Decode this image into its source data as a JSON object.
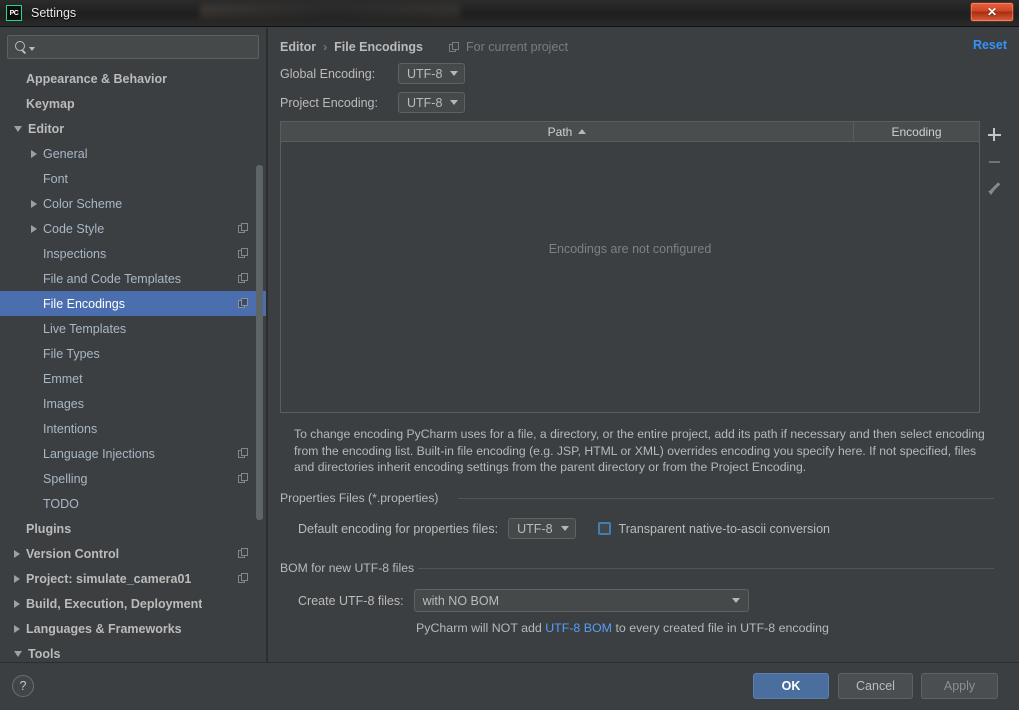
{
  "window": {
    "title": "Settings",
    "app_icon": "pycharm-icon",
    "close_label": "✕",
    "accent": "#21d789"
  },
  "sidebar": {
    "search": {
      "placeholder": "",
      "value": "",
      "icon": "search-icon"
    },
    "items": [
      {
        "label": "Appearance & Behavior",
        "level": 0,
        "arrow": "none",
        "bold": true,
        "scope_icon": false
      },
      {
        "label": "Keymap",
        "level": 0,
        "arrow": "none",
        "bold": true,
        "scope_icon": false
      },
      {
        "label": "Editor",
        "level": 0,
        "arrow": "expanded",
        "bold": true,
        "scope_icon": false
      },
      {
        "label": "General",
        "level": 1,
        "arrow": "collapsed",
        "bold": false,
        "scope_icon": false
      },
      {
        "label": "Font",
        "level": 1,
        "arrow": "none",
        "bold": false,
        "scope_icon": false
      },
      {
        "label": "Color Scheme",
        "level": 1,
        "arrow": "collapsed",
        "bold": false,
        "scope_icon": false
      },
      {
        "label": "Code Style",
        "level": 1,
        "arrow": "collapsed",
        "bold": false,
        "scope_icon": true
      },
      {
        "label": "Inspections",
        "level": 1,
        "arrow": "none",
        "bold": false,
        "scope_icon": true
      },
      {
        "label": "File and Code Templates",
        "level": 1,
        "arrow": "none",
        "bold": false,
        "scope_icon": true
      },
      {
        "label": "File Encodings",
        "level": 1,
        "arrow": "none",
        "bold": false,
        "scope_icon": true,
        "selected": true
      },
      {
        "label": "Live Templates",
        "level": 1,
        "arrow": "none",
        "bold": false,
        "scope_icon": false
      },
      {
        "label": "File Types",
        "level": 1,
        "arrow": "none",
        "bold": false,
        "scope_icon": false
      },
      {
        "label": "Emmet",
        "level": 1,
        "arrow": "none",
        "bold": false,
        "scope_icon": false
      },
      {
        "label": "Images",
        "level": 1,
        "arrow": "none",
        "bold": false,
        "scope_icon": false
      },
      {
        "label": "Intentions",
        "level": 1,
        "arrow": "none",
        "bold": false,
        "scope_icon": false
      },
      {
        "label": "Language Injections",
        "level": 1,
        "arrow": "none",
        "bold": false,
        "scope_icon": true
      },
      {
        "label": "Spelling",
        "level": 1,
        "arrow": "none",
        "bold": false,
        "scope_icon": true
      },
      {
        "label": "TODO",
        "level": 1,
        "arrow": "none",
        "bold": false,
        "scope_icon": false
      },
      {
        "label": "Plugins",
        "level": 0,
        "arrow": "none",
        "bold": true,
        "scope_icon": false
      },
      {
        "label": "Version Control",
        "level": 0,
        "arrow": "collapsed",
        "bold": true,
        "scope_icon": true
      },
      {
        "label": "Project: simulate_camera01",
        "level": 0,
        "arrow": "collapsed",
        "bold": true,
        "scope_icon": true
      },
      {
        "label": "Build, Execution, Deployment",
        "level": 0,
        "arrow": "collapsed",
        "bold": true,
        "scope_icon": false
      },
      {
        "label": "Languages & Frameworks",
        "level": 0,
        "arrow": "collapsed",
        "bold": true,
        "scope_icon": false
      },
      {
        "label": "Tools",
        "level": 0,
        "arrow": "expanded",
        "bold": true,
        "scope_icon": false
      }
    ]
  },
  "main": {
    "breadcrumb": {
      "parent": "Editor",
      "separator": "›",
      "current": "File Encodings"
    },
    "scope_note": "For current project",
    "reset_label": "Reset",
    "global_encoding": {
      "label": "Global Encoding:",
      "value": "UTF-8"
    },
    "project_encoding": {
      "label": "Project Encoding:",
      "value": "UTF-8"
    },
    "table": {
      "columns": [
        "Path",
        "Encoding"
      ],
      "sort_column": "Path",
      "sort_direction": "ascending",
      "rows": [],
      "empty_message": "Encodings are not configured",
      "tools": {
        "add": "+",
        "remove": "−",
        "edit": "✎"
      }
    },
    "description": "To change encoding PyCharm uses for a file, a directory, or the entire project, add its path if necessary and then select encoding from the encoding list. Built-in file encoding (e.g. JSP, HTML or XML) overrides encoding you specify here. If not specified, files and directories inherit encoding settings from the parent directory or from the Project Encoding.",
    "properties_section": {
      "title": "Properties Files (*.properties)",
      "default_encoding_label": "Default encoding for properties files:",
      "default_encoding_value": "UTF-8",
      "checkbox_label": "Transparent native-to-ascii conversion",
      "checkbox_checked": false
    },
    "bom_section": {
      "title": "BOM for new UTF-8 files",
      "create_label": "Create UTF-8 files:",
      "create_value": "with NO BOM",
      "hint_prefix": "PyCharm will NOT add ",
      "hint_link": "UTF-8 BOM",
      "hint_suffix": " to every created file in UTF-8 encoding"
    }
  },
  "footer": {
    "help_label": "?",
    "ok_label": "OK",
    "cancel_label": "Cancel",
    "apply_label": "Apply",
    "apply_enabled": false,
    "ok_color": "#4a6f9e"
  }
}
